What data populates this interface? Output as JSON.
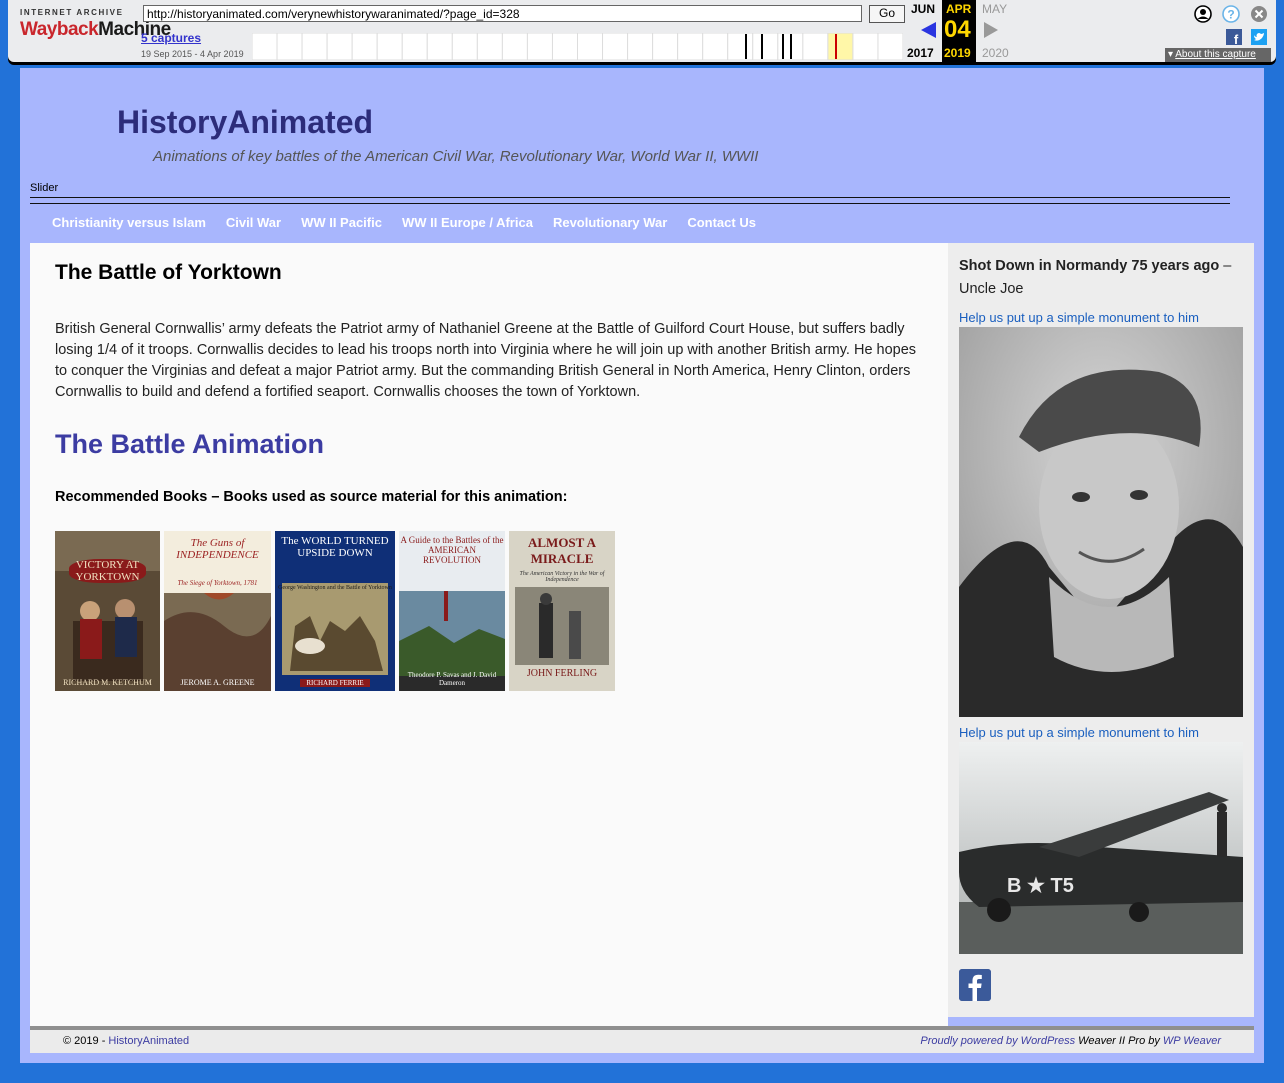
{
  "wayback": {
    "logo_top": "INTERNET ARCHIVE",
    "logo_wayback": "Wayback",
    "logo_machine": "Machine",
    "url": "http://historyanimated.com/verynewhistorywaranimated/?page_id=328",
    "go_label": "Go",
    "captures_label": "5 captures",
    "date_range": "19 Sep 2015 - 4 Apr 2019",
    "prev_month": "JUN",
    "cur_month": "APR",
    "next_month": "MAY",
    "cur_day": "04",
    "prev_year": "2017",
    "cur_year": "2019",
    "next_year": "2020",
    "about_label": "About this capture",
    "icons": [
      "user-icon",
      "help-icon",
      "close-icon",
      "facebook-icon",
      "twitter-icon"
    ]
  },
  "site": {
    "title": "HistoryAnimated",
    "description": "Animations of key battles of the American Civil War, Revolutionary War, World War II, WWII",
    "slider_label": "Slider"
  },
  "nav": {
    "items": [
      {
        "label": "Christianity versus Islam"
      },
      {
        "label": "Civil War"
      },
      {
        "label": "WW II Pacific"
      },
      {
        "label": "WW II Europe / Africa"
      },
      {
        "label": "Revolutionary War"
      },
      {
        "label": "Contact Us"
      }
    ]
  },
  "post": {
    "title": "The Battle of Yorktown",
    "body": "British General Cornwallis’ army defeats the Patriot army of Nathaniel Greene at the Battle of Guilford Court House, but suffers badly losing 1/4 of it troops. Cornwallis decides to lead his troops north into Virginia where he will join up with another British army. He hopes to conquer the Virginias and defeat a major Patriot army. But the commanding British General in North America, Henry Clinton, orders Cornwallis to build and defend a fortified seaport. Cornwallis chooses the town of Yorktown.",
    "animation_title": "The Battle Animation",
    "books_heading": "Recommended Books – Books used as source material for this animation:",
    "books": [
      {
        "title": "VICTORY AT YORKTOWN",
        "author": "RICHARD M. KETCHUM",
        "color": "#7a5a3a"
      },
      {
        "title": "The Guns of INDEPENDENCE",
        "subtitle": "The Siege of Yorktown, 1781",
        "author": "JEROME A. GREENE",
        "color": "#8a6a4a"
      },
      {
        "title": "The WORLD TURNED UPSIDE DOWN",
        "subtitle": "George Washington and the Battle of Yorktown",
        "author": "RICHARD FERRIE",
        "color": "#0f2f77"
      },
      {
        "title": "A Guide to the Battles of the AMERICAN REVOLUTION",
        "author": "Theodore P. Savas and J. David Dameron",
        "color": "#4a6a8a"
      },
      {
        "title": "ALMOST A MIRACLE",
        "subtitle": "The American Victory in the War of Independence",
        "author": "JOHN FERLING",
        "color": "#b8b4a6"
      }
    ]
  },
  "sidebar": {
    "title": "Shot Down in Normandy 75 years ago",
    "title_suffix": " – Uncle Joe",
    "link1": "Help us put up a simple monument to him",
    "link2": "Help us put up a simple monument to him",
    "plane_markings": "B ★ T5"
  },
  "footer": {
    "copyright": "© 2019 - ",
    "site_link": "HistoryAnimated",
    "powered": "Proudly powered by WordPress",
    "theme": " Weaver II Pro by ",
    "theme_link": "WP Weaver"
  }
}
